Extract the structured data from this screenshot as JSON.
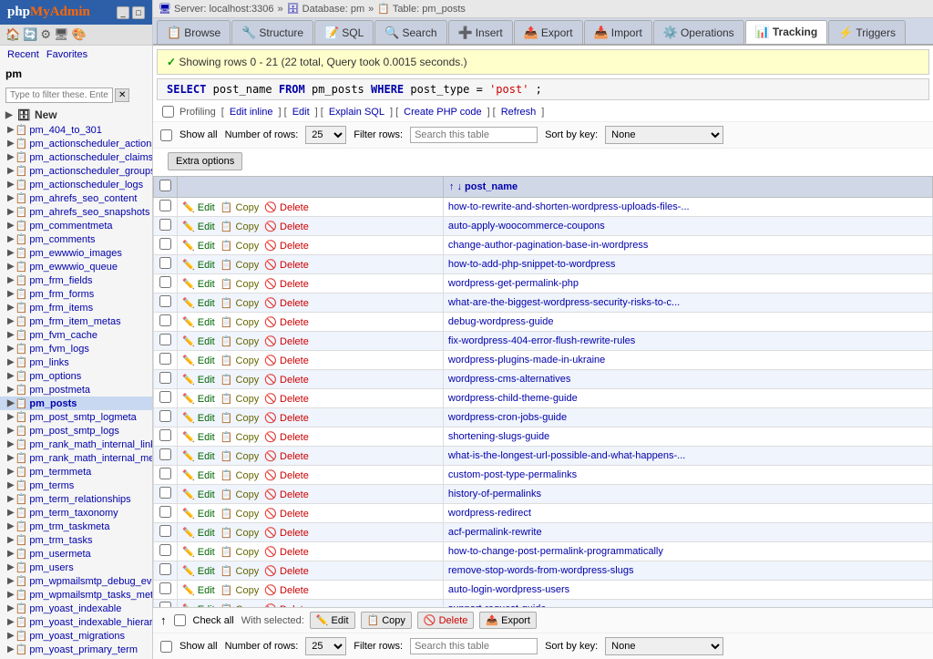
{
  "app": {
    "logo": "phpMyAdmin",
    "logo_php": "php",
    "logo_myadmin": "MyAdmin"
  },
  "topbar": {
    "server": "Server: localhost:3306",
    "database": "Database: pm",
    "table": "Table: pm_posts"
  },
  "navtabs": [
    {
      "id": "browse",
      "label": "Browse",
      "icon": "📋",
      "active": false
    },
    {
      "id": "structure",
      "label": "Structure",
      "icon": "🔧",
      "active": false
    },
    {
      "id": "sql",
      "label": "SQL",
      "icon": "📝",
      "active": false
    },
    {
      "id": "search",
      "label": "Search",
      "icon": "🔍",
      "active": false
    },
    {
      "id": "insert",
      "label": "Insert",
      "icon": "➕",
      "active": false
    },
    {
      "id": "export",
      "label": "Export",
      "icon": "📤",
      "active": false
    },
    {
      "id": "import",
      "label": "Import",
      "icon": "📥",
      "active": false
    },
    {
      "id": "operations",
      "label": "Operations",
      "icon": "⚙️",
      "active": false
    },
    {
      "id": "tracking",
      "label": "Tracking",
      "icon": "📊",
      "active": true
    },
    {
      "id": "triggers",
      "label": "Triggers",
      "icon": "⚡",
      "active": false
    }
  ],
  "query_info": {
    "message": "Showing rows 0 - 21 (22 total, Query took 0.0015 seconds.)"
  },
  "sql_query": "SELECT post_name FROM pm_posts WHERE post_type = 'post';",
  "profiling_label": "Profiling",
  "profiling_links": [
    "Edit inline",
    "Edit",
    "Explain SQL",
    "Create PHP code",
    "Refresh"
  ],
  "filter": {
    "show_all_label": "Show all",
    "num_rows_label": "Number of rows:",
    "num_rows_value": "25",
    "filter_rows_label": "Filter rows:",
    "filter_rows_placeholder": "Search this table",
    "sort_by_label": "Sort by key:",
    "sort_by_value": "None",
    "sort_options": [
      "None"
    ],
    "extra_options_label": "Extra options"
  },
  "table_header": {
    "sort_asc": "↑",
    "sort_desc": "↓",
    "col_name": "post_name"
  },
  "rows": [
    {
      "id": 1,
      "post_name": "how-to-rewrite-and-shorten-wordpress-uploads-files-..."
    },
    {
      "id": 2,
      "post_name": "auto-apply-woocommerce-coupons"
    },
    {
      "id": 3,
      "post_name": "change-author-pagination-base-in-wordpress"
    },
    {
      "id": 4,
      "post_name": "how-to-add-php-snippet-to-wordpress"
    },
    {
      "id": 5,
      "post_name": "wordpress-get-permalink-php"
    },
    {
      "id": 6,
      "post_name": "what-are-the-biggest-wordpress-security-risks-to-c..."
    },
    {
      "id": 7,
      "post_name": "debug-wordpress-guide"
    },
    {
      "id": 8,
      "post_name": "fix-wordpress-404-error-flush-rewrite-rules"
    },
    {
      "id": 9,
      "post_name": "wordpress-plugins-made-in-ukraine"
    },
    {
      "id": 10,
      "post_name": "wordpress-cms-alternatives"
    },
    {
      "id": 11,
      "post_name": "wordpress-child-theme-guide"
    },
    {
      "id": 12,
      "post_name": "wordpress-cron-jobs-guide"
    },
    {
      "id": 13,
      "post_name": "shortening-slugs-guide"
    },
    {
      "id": 14,
      "post_name": "what-is-the-longest-url-possible-and-what-happens-..."
    },
    {
      "id": 15,
      "post_name": "custom-post-type-permalinks"
    },
    {
      "id": 16,
      "post_name": "history-of-permalinks"
    },
    {
      "id": 17,
      "post_name": "wordpress-redirect"
    },
    {
      "id": 18,
      "post_name": "acf-permalink-rewrite"
    },
    {
      "id": 19,
      "post_name": "how-to-change-post-permalink-programmatically"
    },
    {
      "id": 20,
      "post_name": "remove-stop-words-from-wordpress-slugs"
    },
    {
      "id": 21,
      "post_name": "auto-login-wordpress-users"
    },
    {
      "id": 22,
      "post_name": "support-request-guide"
    }
  ],
  "actions": {
    "edit": "Edit",
    "copy": "Copy",
    "delete": "Delete"
  },
  "bottom": {
    "check_all": "Check all",
    "with_selected": "With selected:",
    "edit_btn": "Edit",
    "copy_btn": "Copy",
    "delete_btn": "Delete",
    "export_btn": "Export"
  },
  "sidebar": {
    "db_name": "pm",
    "filter_placeholder": "Type to filter these. Enter to",
    "new_label": "New",
    "tables": [
      "pm_404_to_301",
      "pm_actionscheduler_actions",
      "pm_actionscheduler_claims",
      "pm_actionscheduler_groups",
      "pm_actionscheduler_logs",
      "pm_ahrefs_seo_content",
      "pm_ahrefs_seo_snapshots",
      "pm_commentmeta",
      "pm_comments",
      "pm_ewwwio_images",
      "pm_ewwwio_queue",
      "pm_frm_fields",
      "pm_frm_forms",
      "pm_frm_items",
      "pm_frm_item_metas",
      "pm_fvm_cache",
      "pm_fvm_logs",
      "pm_links",
      "pm_options",
      "pm_postmeta",
      "pm_posts",
      "pm_post_smtp_logmeta",
      "pm_post_smtp_logs",
      "pm_rank_math_internal_links",
      "pm_rank_math_internal_meta",
      "pm_termmeta",
      "pm_terms",
      "pm_term_relationships",
      "pm_term_taxonomy",
      "pm_trm_taskmeta",
      "pm_trm_tasks",
      "pm_usermeta",
      "pm_users",
      "pm_wpmailsmtp_debug_events",
      "pm_wpmailsmtp_tasks_meta",
      "pm_yoast_indexable",
      "pm_yoast_indexable_hierarchy",
      "pm_yoast_migrations",
      "pm_yoast_primary_term"
    ]
  }
}
